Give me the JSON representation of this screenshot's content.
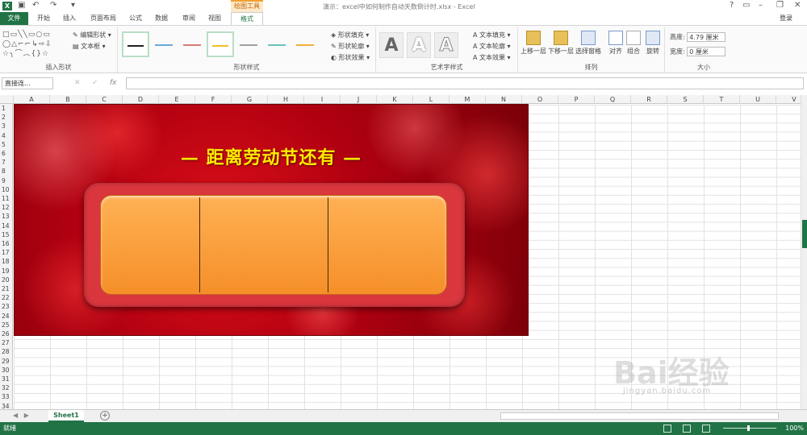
{
  "window": {
    "title": "演示：excel中如何制作自动天数倒计时.xlsx - Excel",
    "context_tab": "绘图工具",
    "login": "登录"
  },
  "tabs": [
    {
      "label": "文件"
    },
    {
      "label": "开始"
    },
    {
      "label": "插入"
    },
    {
      "label": "页面布局"
    },
    {
      "label": "公式"
    },
    {
      "label": "数据"
    },
    {
      "label": "审阅"
    },
    {
      "label": "视图"
    },
    {
      "label": "格式"
    }
  ],
  "ribbon": {
    "insert_shapes": {
      "label": "插入形状",
      "edit_shape": "编辑形状",
      "text_box": "文本框"
    },
    "shape_styles": {
      "label": "形状样式",
      "fill": "形状填充",
      "outline": "形状轮廓",
      "effects": "形状效果"
    },
    "wordart": {
      "label": "艺术字样式",
      "text_fill": "文本填充",
      "text_outline": "文本轮廓",
      "text_effects": "文本效果",
      "sample": "A"
    },
    "arrange": {
      "label": "排列",
      "bring_forward": "上移一层",
      "send_backward": "下移一层",
      "selection_pane": "选择窗格",
      "align": "对齐",
      "group": "组合",
      "rotate": "旋转"
    },
    "size": {
      "label": "大小",
      "height_label": "高度:",
      "height_value": "4.79 厘米",
      "width_label": "宽度:",
      "width_value": "0 厘米"
    }
  },
  "formula_bar": {
    "name_box": "直接连...",
    "fx": "fx"
  },
  "columns": [
    "A",
    "B",
    "C",
    "D",
    "E",
    "F",
    "G",
    "H",
    "I",
    "J",
    "K",
    "L",
    "M",
    "N",
    "O",
    "P",
    "Q",
    "R",
    "S",
    "T",
    "U",
    "V"
  ],
  "rows": [
    "1",
    "2",
    "3",
    "4",
    "5",
    "6",
    "7",
    "8",
    "9",
    "10",
    "11",
    "12",
    "13",
    "14",
    "15",
    "16",
    "17",
    "18",
    "19",
    "20",
    "21",
    "22",
    "23",
    "24",
    "25",
    "26",
    "27",
    "28",
    "29",
    "30",
    "31",
    "32",
    "33",
    "34"
  ],
  "banner": {
    "headline": "— 距离劳动节还有 —"
  },
  "sheets": [
    {
      "label": "Sheet1"
    }
  ],
  "status": {
    "ready": "就绪",
    "zoom": "100%"
  },
  "watermark": {
    "brand": "Bai经验",
    "url": "jingyan.baidu.com"
  },
  "colors": {
    "excel_green": "#217346",
    "banner_red": "#b00010",
    "frame_red": "#d9363e",
    "panel_orange": "#f58f28",
    "headline_yellow": "#ffea00"
  }
}
